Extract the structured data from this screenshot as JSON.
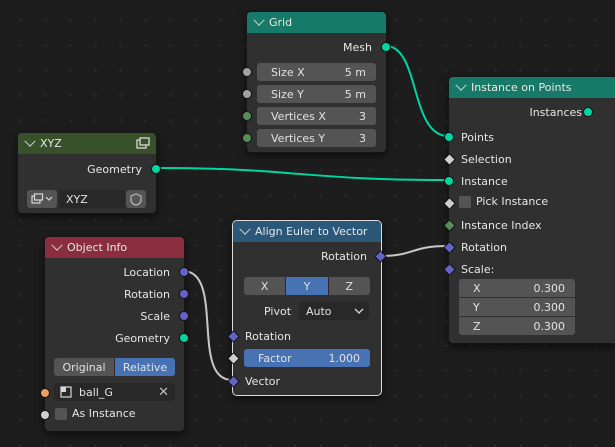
{
  "nodes": {
    "grid": {
      "title": "Grid",
      "output": "Mesh",
      "fields": [
        {
          "label": "Size X",
          "value": "5 m"
        },
        {
          "label": "Size Y",
          "value": "5 m"
        },
        {
          "label": "Vertices X",
          "value": "3"
        },
        {
          "label": "Vertices Y",
          "value": "3"
        }
      ]
    },
    "xyz": {
      "title": "XYZ",
      "output": "Geometry",
      "collection_name": "XYZ"
    },
    "object_info": {
      "title": "Object Info",
      "outputs": [
        "Location",
        "Rotation",
        "Scale",
        "Geometry"
      ],
      "mode_options": [
        "Original",
        "Relative"
      ],
      "mode_selected": "Relative",
      "object_name": "ball_G",
      "as_instance_label": "As Instance"
    },
    "align_euler": {
      "title": "Align Euler to Vector",
      "output": "Rotation",
      "axes": [
        "X",
        "Y",
        "Z"
      ],
      "axis_selected": "Y",
      "pivot_label": "Pivot",
      "pivot_value": "Auto",
      "inputs": {
        "rotation": "Rotation",
        "factor_label": "Factor",
        "factor_value": "1.000",
        "vector": "Vector"
      }
    },
    "instance_on_points": {
      "title": "Instance on Points",
      "output": "Instances",
      "inputs": {
        "points": "Points",
        "selection": "Selection",
        "instance": "Instance",
        "pick_instance": "Pick Instance",
        "instance_index": "Instance Index",
        "rotation": "Rotation",
        "scale": "Scale:"
      },
      "scale_fields": [
        {
          "label": "X",
          "value": "0.300"
        },
        {
          "label": "Y",
          "value": "0.300"
        },
        {
          "label": "Z",
          "value": "0.300"
        }
      ]
    }
  },
  "colors": {
    "geometry_socket": "#00d6a3",
    "vector_socket": "#6363c7",
    "float_socket": "#a1a1a1",
    "object_socket": "#ed9e5c",
    "selected_button": "#4772b3"
  }
}
